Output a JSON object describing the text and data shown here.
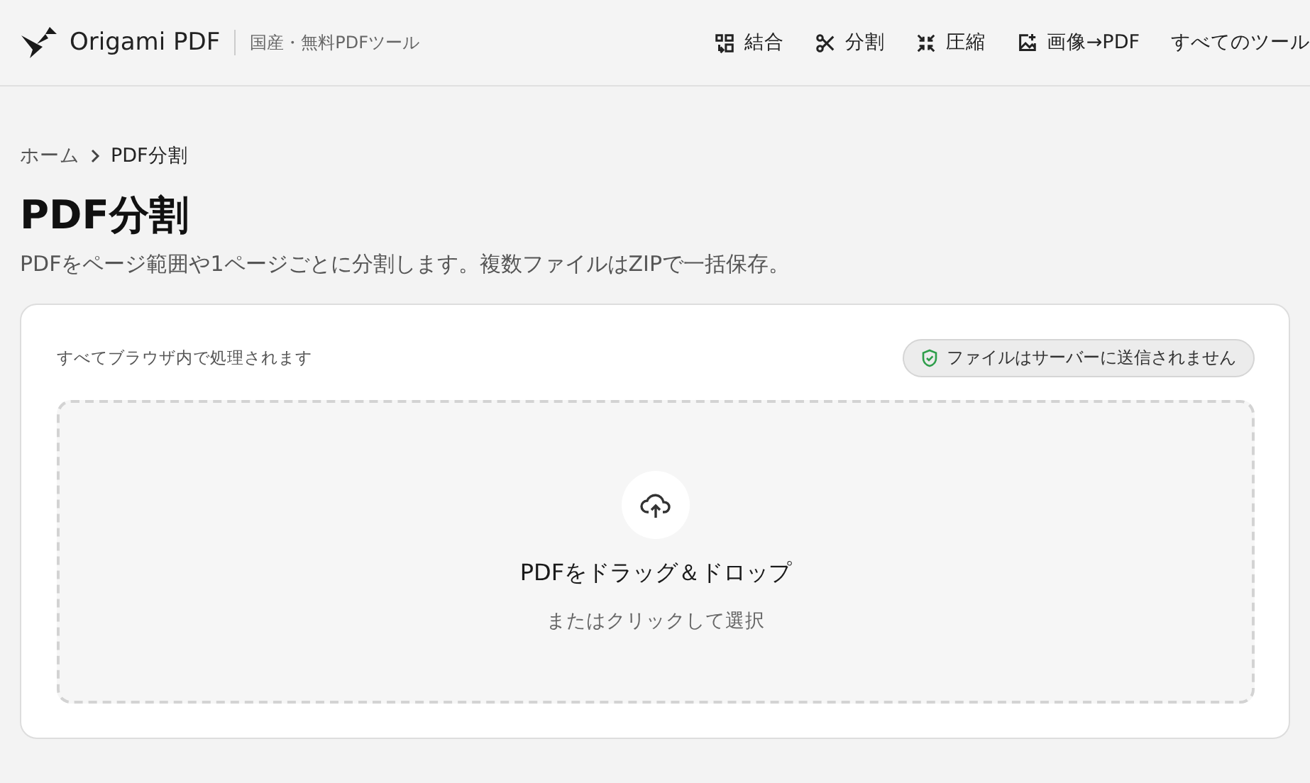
{
  "header": {
    "brand": "Origami PDF",
    "tagline": "国産・無料PDFツール",
    "nav": [
      {
        "kind": "merge",
        "label": "結合"
      },
      {
        "kind": "split",
        "label": "分割"
      },
      {
        "kind": "compress",
        "label": "圧縮"
      },
      {
        "kind": "image",
        "label": "画像→PDF"
      },
      {
        "kind": "text",
        "label": "すべてのツール"
      }
    ]
  },
  "breadcrumb": [
    "ホーム",
    "PDF分割"
  ],
  "title": "PDF分割",
  "description": "PDFをページ範囲や1ページごとに分割します。複数ファイルはZIPで一括保存。",
  "card": {
    "note": "すべてブラウザ内で処理されます",
    "badge": "ファイルはサーバーに送信されません",
    "dropzone": {
      "title": "PDFをドラッグ＆ドロップ",
      "subtitle": "またはクリックして選択"
    }
  }
}
